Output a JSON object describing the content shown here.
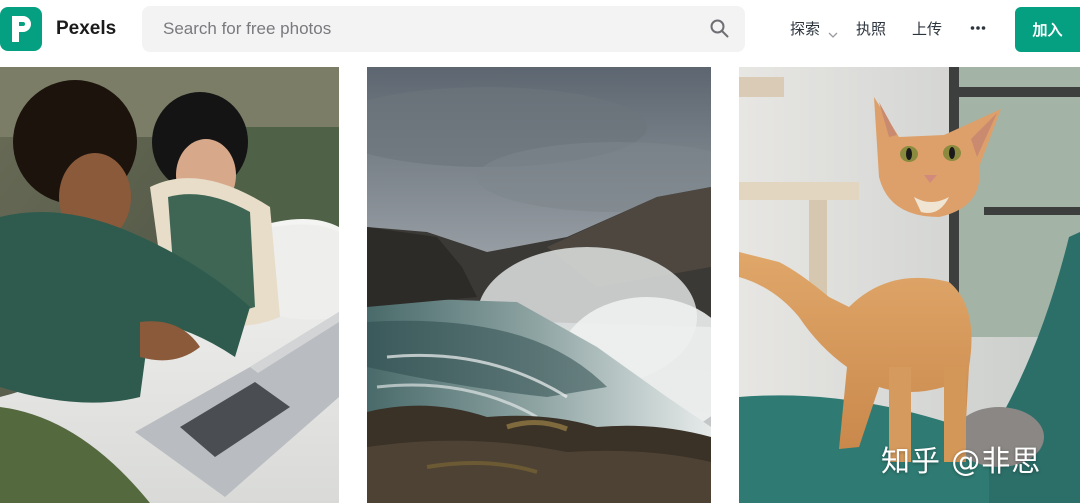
{
  "brand": {
    "name": "Pexels",
    "color": "#05a081"
  },
  "search": {
    "placeholder": "Search for free photos",
    "value": ""
  },
  "nav": {
    "explore": "探索",
    "license": "执照",
    "upload": "上传",
    "more": "•••",
    "join": "加入"
  },
  "photos": [
    {
      "subject": "Two women in green sweaters looking at a laptop on a bed"
    },
    {
      "subject": "Waterfall gorge with mist under a cloudy sky"
    },
    {
      "subject": "Orange tabby cat standing on a teal chair"
    }
  ],
  "watermark": "知乎 @非思"
}
